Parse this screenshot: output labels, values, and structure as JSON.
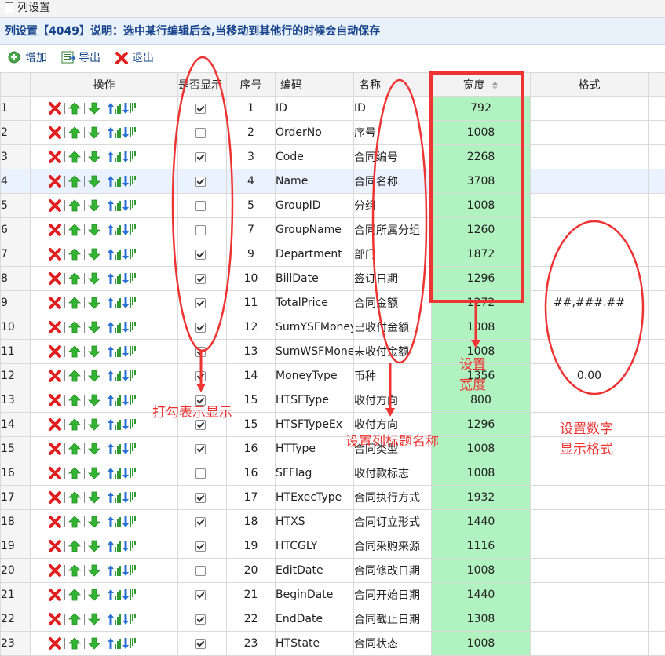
{
  "window": {
    "title": "列设置"
  },
  "description": "列设置【4049】说明：选中某行编辑后会,当移动到其他行的时候会自动保存",
  "toolbar": {
    "add": "增加",
    "export": "导出",
    "exit": "退出"
  },
  "columns": {
    "ops": "操作",
    "visible": "是否显示",
    "seq": "序号",
    "code": "编码",
    "name": "名称",
    "width": "宽度",
    "format": "格式"
  },
  "rows": [
    {
      "rn": "1",
      "visible": true,
      "seq": "1",
      "code": "ID",
      "name": "ID",
      "width": "792",
      "format": ""
    },
    {
      "rn": "2",
      "visible": false,
      "seq": "2",
      "code": "OrderNo",
      "name": "序号",
      "width": "1008",
      "format": ""
    },
    {
      "rn": "3",
      "visible": true,
      "seq": "3",
      "code": "Code",
      "name": "合同编号",
      "width": "2268",
      "format": ""
    },
    {
      "rn": "4",
      "visible": true,
      "seq": "4",
      "code": "Name",
      "name": "合同名称",
      "width": "3708",
      "format": ""
    },
    {
      "rn": "5",
      "visible": false,
      "seq": "5",
      "code": "GroupID",
      "name": "分组",
      "width": "1008",
      "format": ""
    },
    {
      "rn": "6",
      "visible": false,
      "seq": "7",
      "code": "GroupName",
      "name": "合同所属分组",
      "width": "1260",
      "format": ""
    },
    {
      "rn": "7",
      "visible": true,
      "seq": "9",
      "code": "Department",
      "name": "部门",
      "width": "1872",
      "format": ""
    },
    {
      "rn": "8",
      "visible": true,
      "seq": "10",
      "code": "BillDate",
      "name": "签订日期",
      "width": "1296",
      "format": ""
    },
    {
      "rn": "9",
      "visible": true,
      "seq": "11",
      "code": "TotalPrice",
      "name": "合同金额",
      "width": "1272",
      "format": "##,###.##"
    },
    {
      "rn": "10",
      "visible": true,
      "seq": "12",
      "code": "SumYSFMoney",
      "name": "已收付金额",
      "width": "1008",
      "format": ""
    },
    {
      "rn": "11",
      "visible": true,
      "seq": "13",
      "code": "SumWSFMoney",
      "name": "未收付金额",
      "width": "1008",
      "format": ""
    },
    {
      "rn": "12",
      "visible": true,
      "seq": "14",
      "code": "MoneyType",
      "name": "币种",
      "width": "1356",
      "format": "0.00"
    },
    {
      "rn": "13",
      "visible": true,
      "seq": "15",
      "code": "HTSFType",
      "name": "收付方向",
      "width": "800",
      "format": ""
    },
    {
      "rn": "14",
      "visible": true,
      "seq": "15",
      "code": "HTSFTypeEx",
      "name": "收付方向",
      "width": "1296",
      "format": ""
    },
    {
      "rn": "15",
      "visible": true,
      "seq": "16",
      "code": "HTType",
      "name": "合同类型",
      "width": "1008",
      "format": ""
    },
    {
      "rn": "16",
      "visible": false,
      "seq": "16",
      "code": "SFFlag",
      "name": "收付款标志",
      "width": "1008",
      "format": ""
    },
    {
      "rn": "17",
      "visible": true,
      "seq": "17",
      "code": "HTExecType",
      "name": "合同执行方式",
      "width": "1932",
      "format": ""
    },
    {
      "rn": "18",
      "visible": true,
      "seq": "18",
      "code": "HTXS",
      "name": "合同订立形式",
      "width": "1440",
      "format": ""
    },
    {
      "rn": "19",
      "visible": true,
      "seq": "19",
      "code": "HTCGLY",
      "name": "合同采购来源",
      "width": "1116",
      "format": ""
    },
    {
      "rn": "20",
      "visible": false,
      "seq": "20",
      "code": "EditDate",
      "name": "合同修改日期",
      "width": "1008",
      "format": ""
    },
    {
      "rn": "21",
      "visible": true,
      "seq": "21",
      "code": "BeginDate",
      "name": "合同开始日期",
      "width": "1440",
      "format": ""
    },
    {
      "rn": "22",
      "visible": true,
      "seq": "22",
      "code": "EndDate",
      "name": "合同截止日期",
      "width": "1308",
      "format": ""
    },
    {
      "rn": "23",
      "visible": true,
      "seq": "23",
      "code": "HTState",
      "name": "合同状态",
      "width": "1008",
      "format": ""
    }
  ],
  "selected_row": "4",
  "annotations": {
    "checkbox": "打勾表示显示",
    "name": "设置列标题名称",
    "width_line1": "设置",
    "width_line2": "宽度",
    "format_line1": "设置数字",
    "format_line2": "显示格式"
  },
  "colors": {
    "annotation": "#ee3333",
    "width_column": "#b0f2c0",
    "header_text": "#15428b",
    "delete": "#e02020",
    "up": "#33b533"
  }
}
